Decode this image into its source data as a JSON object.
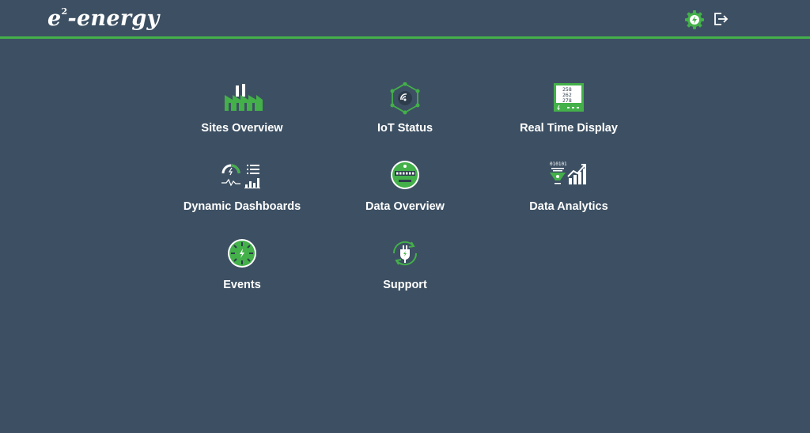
{
  "header": {
    "logo_main": "e",
    "logo_sup": "2",
    "logo_rest": "-energy",
    "settings_icon": "gear-bolt-icon",
    "logout_icon": "logout-icon"
  },
  "menu": {
    "items": [
      {
        "label": "Sites Overview",
        "icon": "factory-icon"
      },
      {
        "label": "IoT Status",
        "icon": "iot-network-icon"
      },
      {
        "label": "Real Time Display",
        "icon": "meter-display-icon"
      },
      {
        "label": "Dynamic Dashboards",
        "icon": "dashboard-widgets-icon"
      },
      {
        "label": "Data Overview",
        "icon": "energy-meter-icon"
      },
      {
        "label": "Data Analytics",
        "icon": "analytics-funnel-icon"
      },
      {
        "label": "Events",
        "icon": "events-clock-icon"
      },
      {
        "label": "Support",
        "icon": "plug-refresh-icon"
      }
    ]
  },
  "meter_readings": [
    "258",
    "262",
    "278"
  ],
  "binary_text": "010101",
  "colors": {
    "background": "#3d5063",
    "accent": "#43b049",
    "text": "#ffffff"
  }
}
